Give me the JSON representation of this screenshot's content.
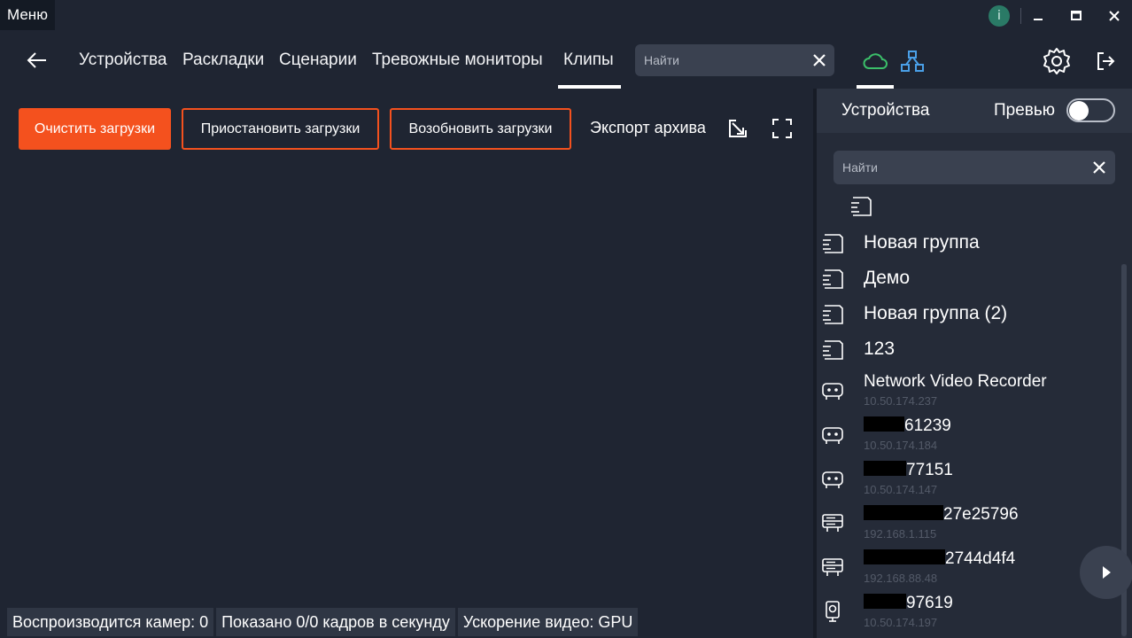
{
  "titlebar": {
    "menu_label": "Меню",
    "info_label": "i"
  },
  "nav": {
    "tabs": [
      "Устройства",
      "Раскладки",
      "Сценарии",
      "Тревожные мониторы",
      "Клипы"
    ],
    "active_tab": "Клипы",
    "search_placeholder": "Найти"
  },
  "toolbar": {
    "clear_label": "Очистить загрузки",
    "pause_label": "Приостановить загрузки",
    "resume_label": "Возобновить загрузки",
    "export_label": "Экспорт архива"
  },
  "status": {
    "cameras": "Воспроизводится камер: 0",
    "fps": "Показано 0/0 кадров в секунду",
    "accel": "Ускорение видео: GPU"
  },
  "sidebar": {
    "title": "Устройства",
    "preview_label": "Превью",
    "preview_on": false,
    "search_placeholder": "Найти",
    "groups": [
      "Новая группа",
      "Демо",
      "Новая группа (2)",
      "123"
    ],
    "devices": [
      {
        "name": "Network Video Recorder",
        "ip": "10.50.174.237",
        "icon": "nvr-icon"
      },
      {
        "name": "61239",
        "ip": "10.50.174.184",
        "icon": "nvr-icon"
      },
      {
        "name": "77151",
        "ip": "10.50.174.147",
        "icon": "nvr-icon"
      },
      {
        "name": "27e25796",
        "ip": "192.168.1.115",
        "icon": "server-icon"
      },
      {
        "name": "2744d4f4",
        "ip": "192.168.88.48",
        "icon": "server-icon"
      },
      {
        "name": "97619",
        "ip": "10.50.174.197",
        "icon": "camera-icon"
      }
    ]
  },
  "colors": {
    "accent": "#f4511e",
    "background": "#1f2532",
    "panel": "#252b38",
    "cloud_icon": "#3bbf6a",
    "topology_icon": "#4aa0e8"
  }
}
